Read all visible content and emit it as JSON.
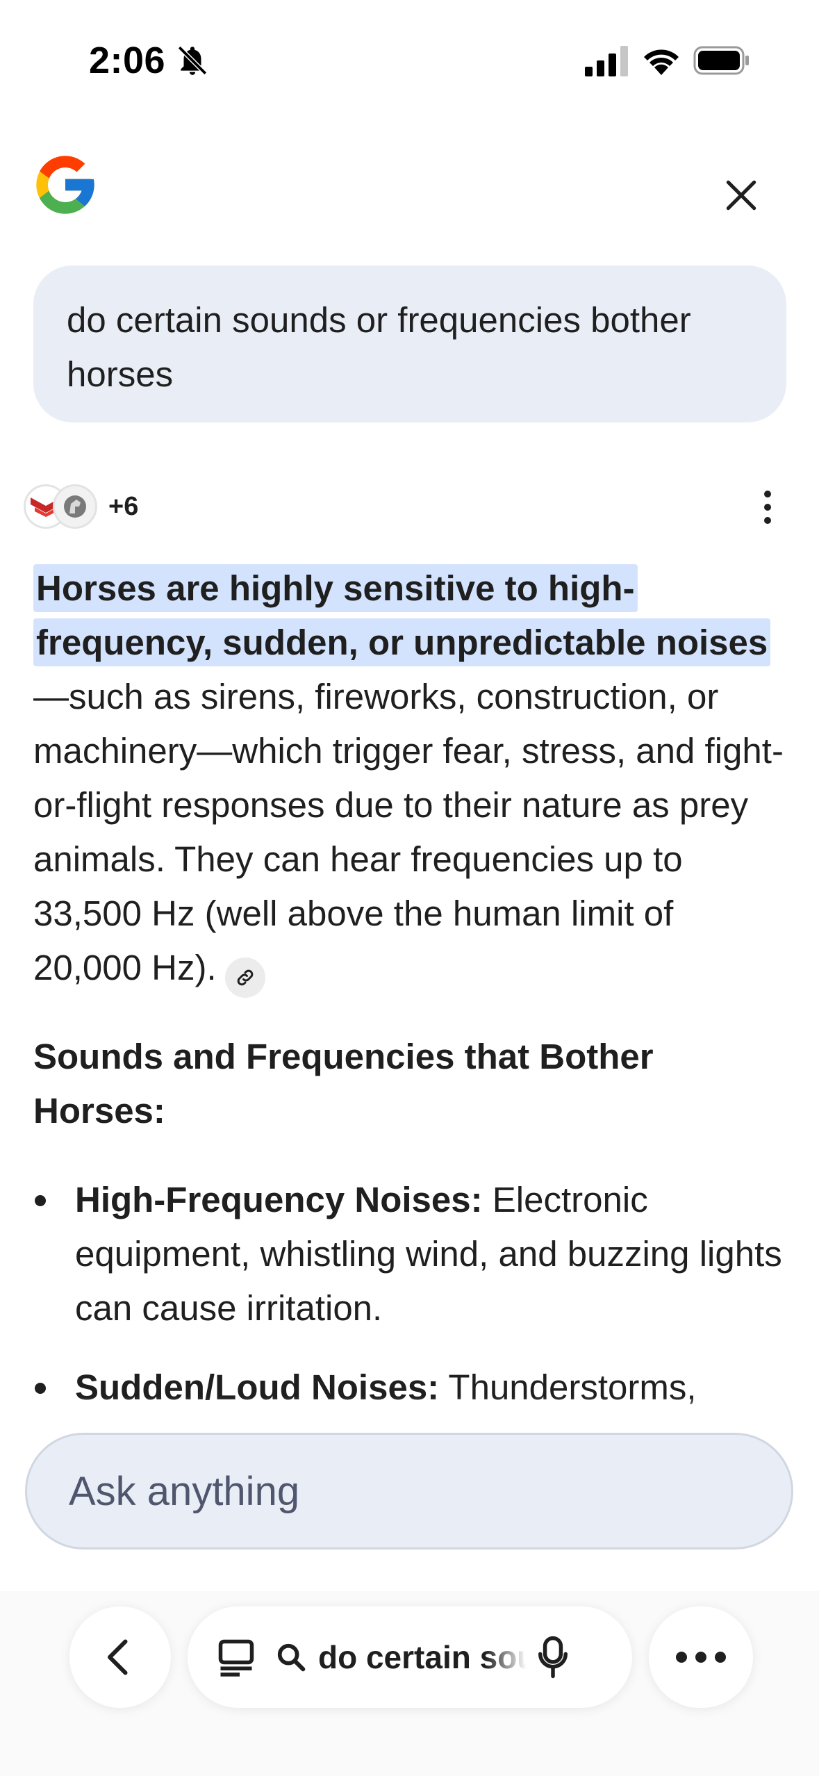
{
  "status_bar": {
    "time": "2:06",
    "icons": [
      "bell-off-icon",
      "cellular-signal-icon",
      "wifi-icon",
      "battery-icon"
    ]
  },
  "header": {
    "logo": "google-g-logo",
    "close_icon": "close-icon"
  },
  "query": {
    "text": "do certain sounds or frequencies bother horses"
  },
  "sources": {
    "icons": [
      "source-favicon-chevron",
      "source-favicon-horse"
    ],
    "count_label": "+6"
  },
  "answer": {
    "highlighted": "Horses are highly sensitive to high-frequency, sudden, or unpredictable noises",
    "body": "—such as sirens, fireworks, construction, or machinery—which trigger fear, stress, and fight-or-flight responses due to their nature as prey animals. They can hear frequencies up to 33,500 Hz (well above the human limit of 20,000 Hz).",
    "link_icon": "link-icon"
  },
  "section": {
    "title": "Sounds and Frequencies that Bother Horses:",
    "bullets": [
      {
        "label": "High-Frequency Noises:",
        "text": "Electronic equipment, whistling wind, and buzzing lights can cause irritation."
      },
      {
        "label": "Sudden/Loud Noises:",
        "text": "Thunderstorms,"
      }
    ]
  },
  "ask_bar": {
    "placeholder": "Ask anything"
  },
  "toolbar": {
    "url_text": "do certain sou",
    "icons": [
      "back-icon",
      "tabs-icon",
      "search-icon",
      "mic-icon",
      "more-horiz-icon"
    ]
  },
  "colors": {
    "highlight": "#d3e3fd",
    "bubble": "#e9eef6",
    "text": "#1f1f1f",
    "placeholder": "#4f566d"
  }
}
